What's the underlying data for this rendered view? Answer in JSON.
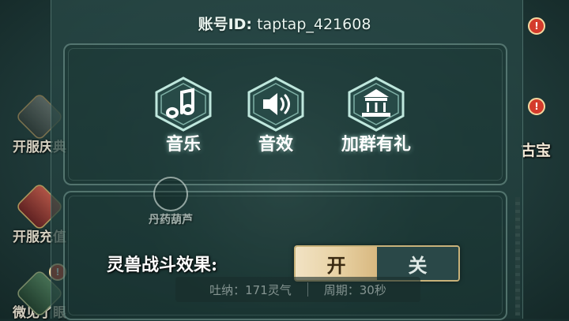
{
  "header": {
    "account_label": "账号ID:",
    "account_value": "taptap_421608"
  },
  "settings_buttons": [
    {
      "label": "音乐",
      "icon": "music-note-icon"
    },
    {
      "label": "音效",
      "icon": "speaker-icon"
    },
    {
      "label": "加群有礼",
      "icon": "pavilion-icon"
    }
  ],
  "background": {
    "left_menu": [
      {
        "label": "开服庆典"
      },
      {
        "label": "开服充值"
      },
      {
        "label": "微见了眼"
      }
    ],
    "right_menu": [
      {
        "label": "古宝"
      }
    ],
    "hulu_label": "丹药葫芦",
    "badge": "!"
  },
  "battle_effect": {
    "label": "灵兽战斗效果:",
    "on_label": "开",
    "off_label": "关",
    "selected": "开"
  },
  "info": {
    "tuna": "吐纳：171灵气",
    "cycle": "周期：30秒"
  },
  "colors": {
    "accent_gold": "#c8b27a",
    "panel_teal": "#284846",
    "badge_red": "#d43b2c"
  }
}
